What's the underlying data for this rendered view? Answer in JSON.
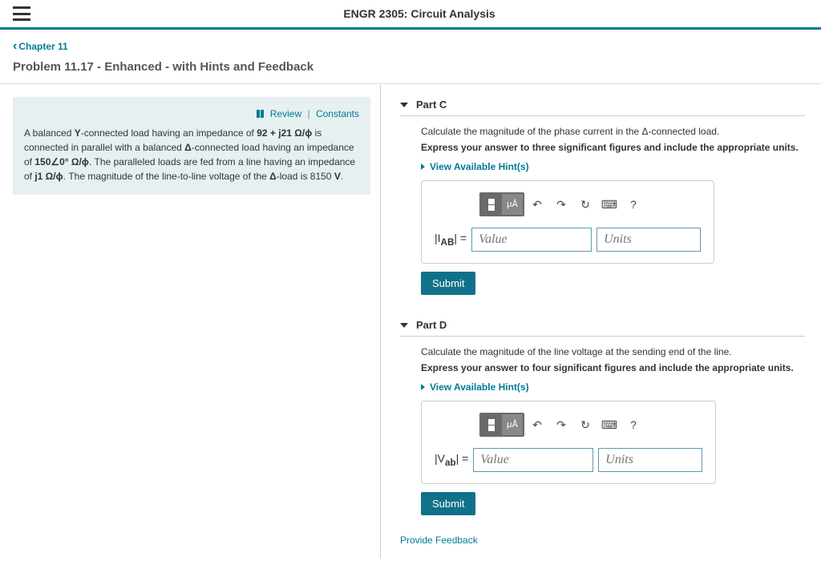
{
  "header": {
    "course_title": "ENGR 2305: Circuit Analysis"
  },
  "nav": {
    "chapter_link": "Chapter 11",
    "problem_title": "Problem 11.17 - Enhanced - with Hints and Feedback"
  },
  "info": {
    "review": "Review",
    "constants": "Constants",
    "text_1": "A balanced ",
    "text_2": "-connected load having an impedance of ",
    "imp1": "92 + j21 Ω/ϕ",
    "text_3": " is connected in parallel with a balanced ",
    "text_4": "-connected load having an impedance of ",
    "imp2": "150∠0° Ω/ϕ",
    "text_5": ". The paralleled loads are fed from a line having an impedance of ",
    "imp3": "j1 Ω/ϕ",
    "text_6": ". The magnitude of the line-to-line voltage of the ",
    "text_7": "-load is 8150 ",
    "text_8": "."
  },
  "parts": {
    "c": {
      "label": "Part C",
      "instruction": "Calculate the magnitude of the phase current in the Δ-connected load.",
      "express": "Express your answer to three significant figures and include the appropriate units.",
      "hints": "View Available Hint(s)",
      "var_prefix": "|I",
      "var_sub": "AB",
      "var_suffix": "| =",
      "value_ph": "Value",
      "units_ph": "Units",
      "submit": "Submit"
    },
    "d": {
      "label": "Part D",
      "instruction": "Calculate the magnitude of the line voltage at the sending end of the line.",
      "express": "Express your answer to four significant figures and include the appropriate units.",
      "hints": "View Available Hint(s)",
      "var_prefix": "|V",
      "var_sub": "ab",
      "var_suffix": "| =",
      "value_ph": "Value",
      "units_ph": "Units",
      "submit": "Submit"
    }
  },
  "feedback_link": "Provide Feedback",
  "toolbar": {
    "units_btn": "μÅ",
    "help": "?"
  }
}
